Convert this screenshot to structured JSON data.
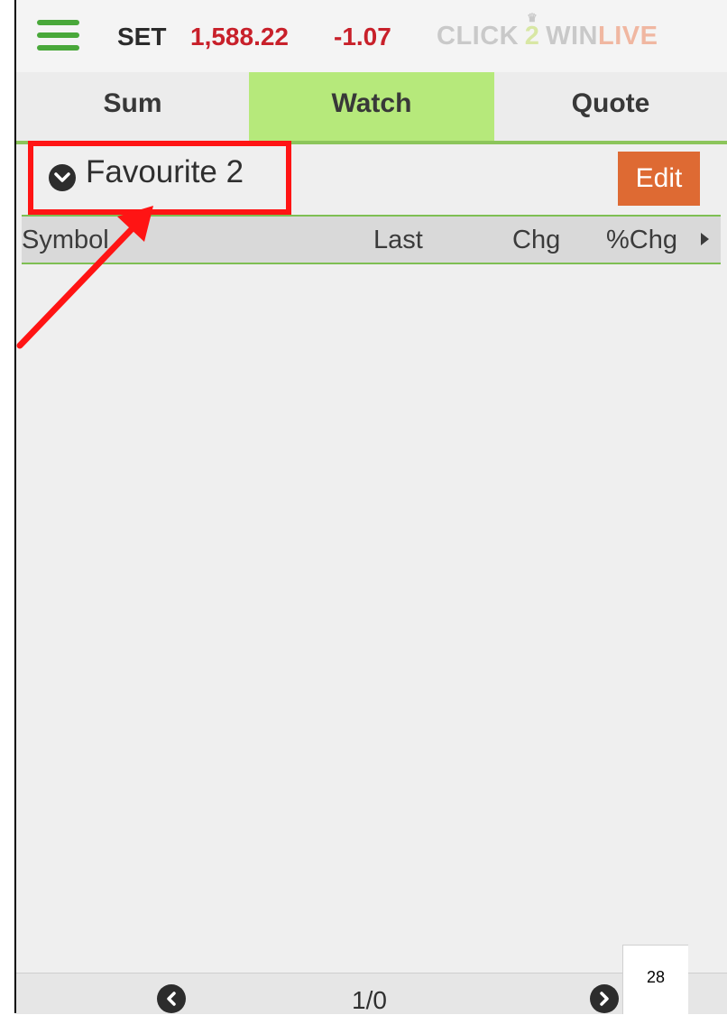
{
  "header": {
    "index_name": "SET",
    "index_value": "1,588.22",
    "index_change": "-1.07",
    "logo": {
      "click": "CLICK",
      "two": "2",
      "win": "WIN",
      "live": "LIVE"
    }
  },
  "tabs": [
    {
      "label": "Sum",
      "active": false
    },
    {
      "label": "Watch",
      "active": true
    },
    {
      "label": "Quote",
      "active": false
    }
  ],
  "watchlist": {
    "group_name": "Favourite 2",
    "edit_label": "Edit"
  },
  "table": {
    "headers": [
      "Symbol",
      "Last",
      "Chg",
      "%Chg"
    ]
  },
  "pagination": {
    "page": "1/0"
  },
  "document": {
    "page_number": "28"
  },
  "colors": {
    "accent_green": "#49a83a",
    "active_tab": "#b6e97b",
    "negative_red": "#c8202a",
    "edit_orange": "#de6a33",
    "annotation_red": "#ff1414"
  }
}
